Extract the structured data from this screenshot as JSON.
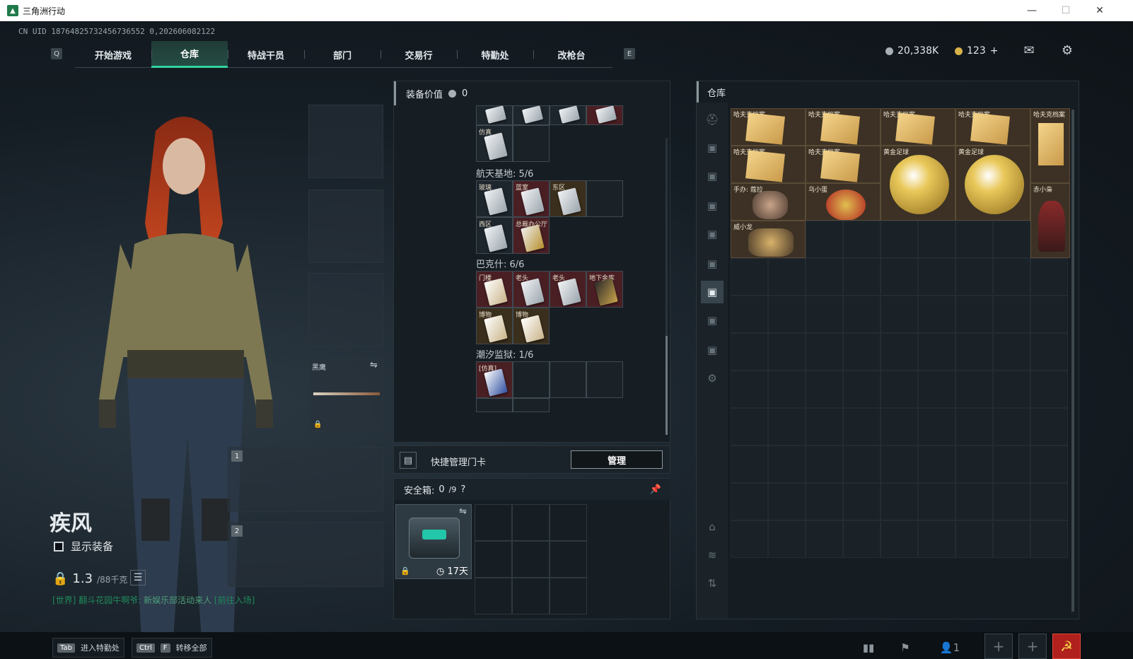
{
  "window": {
    "title": "三角洲行动",
    "minimize": "—",
    "maximize": "☐",
    "close": "✕"
  },
  "uid": "CN UID 18764825732456736552 0,202606082122",
  "nav": {
    "left_key": "Q",
    "right_key": "E",
    "tabs": [
      "开始游戏",
      "仓库",
      "特战干员",
      "部门",
      "交易行",
      "特勤处",
      "改枪台"
    ],
    "active_index": 1
  },
  "resources": {
    "silver": "20,338K",
    "gold": "123",
    "gold_plus": "+"
  },
  "icons": {
    "mail": "mail-icon",
    "settings": "gear-icon"
  },
  "character": {
    "name": "疾风",
    "show_equipment": "显示装备",
    "weight": "1.3",
    "weight_max": "/88千克"
  },
  "chat": {
    "channel": "[世界]",
    "sender": "翻斗花园牛啊爷:",
    "message": "新娱乐部活动来人",
    "link": "[前往入场]"
  },
  "equipment": {
    "melee_label": "黑鹰",
    "weapon1": "1",
    "weapon2": "2"
  },
  "keys_panel": {
    "value_label": "装备价值",
    "value": "0",
    "groups": [
      {
        "title": "航天基地: 5/6",
        "cards": [
          "玻璃",
          "蓝室",
          "东区",
          "",
          "西区",
          "总裁办公厅"
        ]
      },
      {
        "title": "巴克什: 6/6",
        "cards": [
          "门楼",
          "老头",
          "老头",
          "地下金库",
          "博物",
          "博物"
        ]
      },
      {
        "title": "潮汐监狱: 1/6",
        "cards": [
          "[仿真]",
          "",
          "",
          ""
        ]
      }
    ],
    "top_card": "仿真",
    "quick_manage": "快捷管理门卡",
    "manage_button": "管理"
  },
  "safe_box": {
    "label": "安全箱:",
    "count": "0",
    "capacity": "/9",
    "help": "?",
    "days": "17天"
  },
  "warehouse": {
    "title": "仓库",
    "items": [
      {
        "label": "哈夫克档案"
      },
      {
        "label": "哈夫克档案"
      },
      {
        "label": "哈夫克档案"
      },
      {
        "label": "哈夫克档案"
      },
      {
        "label": "哈夫克档案"
      },
      {
        "label": "哈夫克档案"
      },
      {
        "label": "哈夫克档案"
      },
      {
        "label": "黄金足球"
      },
      {
        "label": "黄金足球"
      },
      {
        "label": "手办: 蔻拉"
      },
      {
        "label": "乌小蛋"
      },
      {
        "label": "赤小枭"
      },
      {
        "label": "威小龙"
      }
    ]
  },
  "bottom": {
    "tab_key": "Tab",
    "tab_label": "进入特勤处",
    "ctrl_key": "Ctrl",
    "f_key": "F",
    "transfer_label": "转移全部",
    "friends": "1"
  }
}
